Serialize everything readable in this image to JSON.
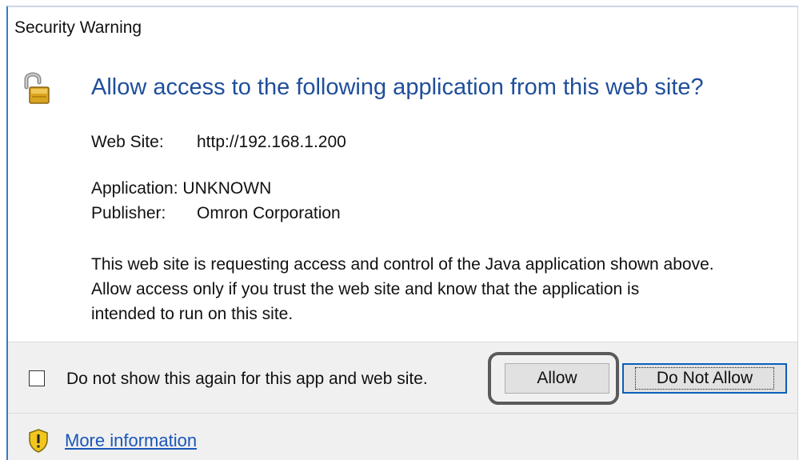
{
  "dialog": {
    "title": "Security Warning",
    "heading": "Allow access to the following application from this web site?",
    "web_site_label": "Web Site:",
    "web_site_value": "http://192.168.1.200",
    "application_label": "Application:",
    "application_value": "UNKNOWN",
    "publisher_label": "Publisher:",
    "publisher_value": "Omron Corporation",
    "message_lines": [
      "This web site is requesting access and control of the Java application shown above.",
      "Allow access only if you trust the web site and know that the application is",
      "intended to run on this site."
    ]
  },
  "footer": {
    "checkbox_label": "Do not show this again for this app and web site.",
    "checkbox_checked": false,
    "allow_label": "Allow",
    "deny_label": "Do Not Allow",
    "more_info_label": "More information"
  },
  "colors": {
    "heading": "#1f4e9b",
    "link": "#1a56b8",
    "default_button_border": "#0b5fba",
    "callout_border": "#5a5a5a",
    "footer_bg": "#f0f0f0"
  },
  "icons": {
    "header": "padlock-icon",
    "info": "warning-shield-icon"
  }
}
